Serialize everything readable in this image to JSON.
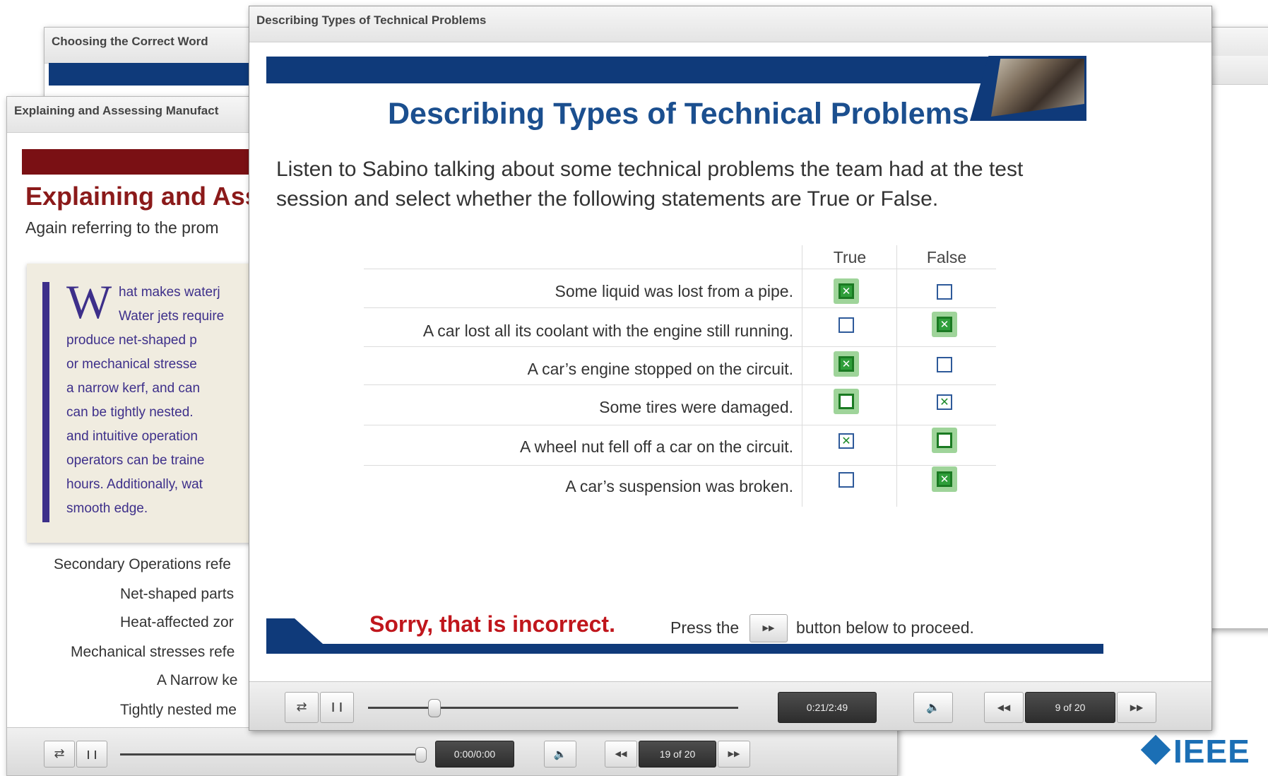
{
  "back_window_2": {
    "title": "Choosing the Correct Word"
  },
  "back_window_1": {
    "title": "Explaining and Assessing Manufact",
    "heading": "Explaining and Ass",
    "intro": "Again referring to the prom",
    "note_dropcap": "W",
    "note_lines": [
      "hat makes waterj",
      "Water jets require",
      "produce net-shaped p",
      "or mechanical stresse",
      "a narrow kerf, and can",
      "can be tightly nested.",
      "and intuitive operation",
      "operators can be traine",
      "hours. Additionally, wat",
      "smooth edge."
    ],
    "list_items": [
      "Secondary Operations refe",
      "Net-shaped parts",
      "Heat-affected zor",
      "Mechanical stresses refe",
      "A Narrow ke",
      "Tightly nested me"
    ],
    "time": "0:00/0:00",
    "page": "19 of 20",
    "accent_color": "#7a1014"
  },
  "main_window": {
    "title": "Describing Types of Technical Problems",
    "heading": "Describing Types of Technical Problems",
    "instructions_line1": "Listen to Sabino talking about some technical problems the team had at the test",
    "instructions_line2": "session and select whether the following statements are True or False.",
    "col_true": "True",
    "col_false": "False",
    "rows": [
      {
        "statement": "Some liquid was lost from a pipe."
      },
      {
        "statement": "A car lost all its coolant with the engine still running."
      },
      {
        "statement": "A car’s engine stopped on the circuit."
      },
      {
        "statement": "Some tires were damaged."
      },
      {
        "statement": "A wheel nut fell off a car on the circuit."
      },
      {
        "statement": "A car’s suspension was broken."
      }
    ],
    "feedback": "Sorry, that is incorrect.",
    "proceed_before": "Press the",
    "proceed_button_glyph": "▶▶",
    "proceed_after": "button below to proceed.",
    "time": "0:21/2:49",
    "page": "9 of 20",
    "progress_fraction": 0.1,
    "accent_color": "#0f3a7a",
    "feedback_color": "#c0161c"
  },
  "controls": {
    "transcript_glyph": "⇄",
    "pause_glyph": "❙❙",
    "volume_glyph": "🔈",
    "prev_glyph": "◀◀",
    "next_glyph": "▶▶"
  },
  "logo": {
    "text": "IEEE"
  }
}
